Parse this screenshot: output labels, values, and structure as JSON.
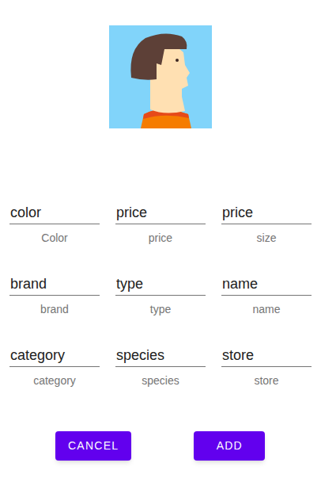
{
  "fields": [
    {
      "value": "color",
      "label": "Color"
    },
    {
      "value": "price",
      "label": "price"
    },
    {
      "value": "price",
      "label": "size"
    },
    {
      "value": "brand",
      "label": "brand"
    },
    {
      "value": "type",
      "label": "type"
    },
    {
      "value": "name",
      "label": "name"
    },
    {
      "value": "category",
      "label": "category"
    },
    {
      "value": "species",
      "label": "species"
    },
    {
      "value": "store",
      "label": "store"
    }
  ],
  "buttons": [
    {
      "label": "CANCEL"
    },
    {
      "label": "ADD"
    }
  ]
}
